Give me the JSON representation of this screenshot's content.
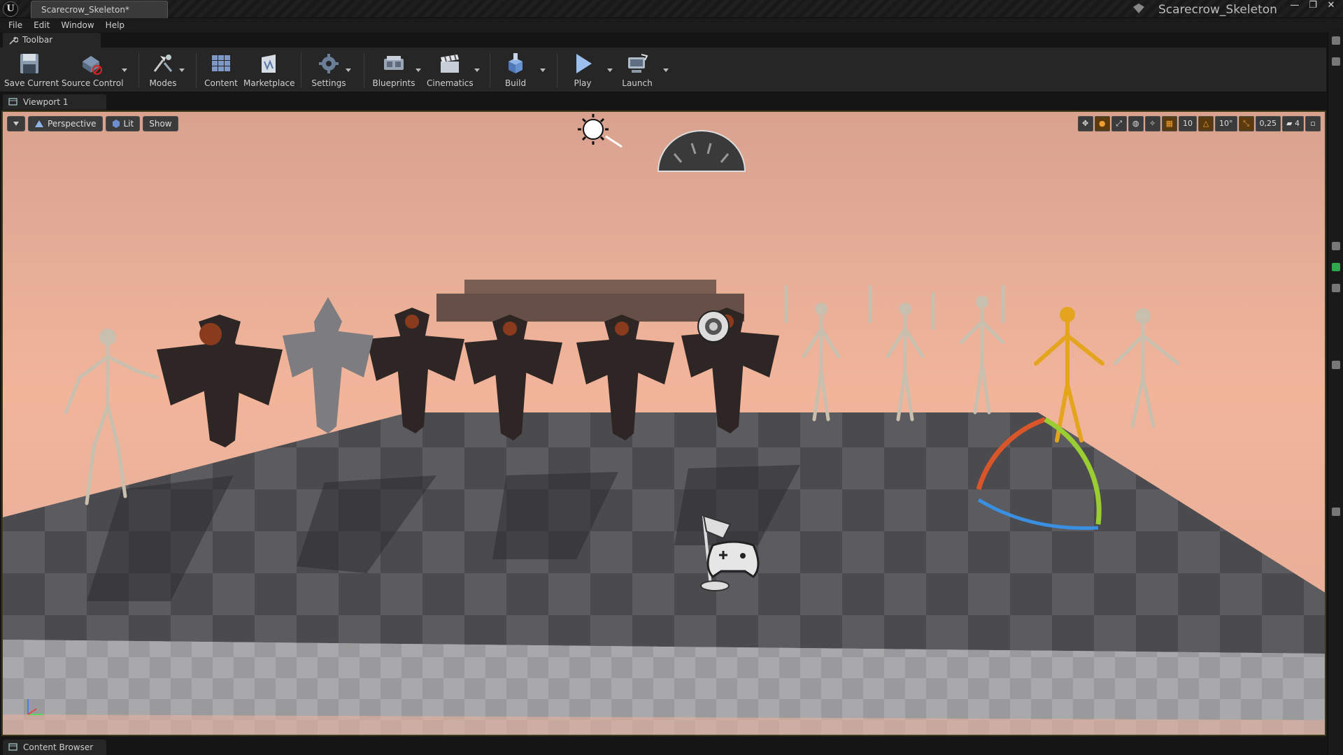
{
  "window": {
    "document_tab": "Scarecrow_Skeleton*",
    "project_title": "Scarecrow_Skeleton",
    "logo": "U",
    "buttons": [
      "—",
      "❐",
      "✕"
    ]
  },
  "menu": [
    "File",
    "Edit",
    "Window",
    "Help"
  ],
  "toolbar_tab": "Toolbar",
  "toolbar": {
    "save_current": "Save Current",
    "source_control": "Source Control",
    "modes": "Modes",
    "content": "Content",
    "marketplace": "Marketplace",
    "settings": "Settings",
    "blueprints": "Blueprints",
    "cinematics": "Cinematics",
    "build": "Build",
    "play": "Play",
    "launch": "Launch"
  },
  "viewport_tab": "Viewport 1",
  "viewport": {
    "perspective": "Perspective",
    "lit": "Lit",
    "show": "Show",
    "grid_snap": "10",
    "rotation_snap": "10°",
    "scale_snap": "0,25",
    "camera_speed": "4"
  },
  "content_browser_tab": "Content Browser",
  "colors": {
    "accent_orange": "#f0a030",
    "panel": "#262626",
    "sky_top": "#d9a28e",
    "sky_horizon": "#f2b59a"
  }
}
